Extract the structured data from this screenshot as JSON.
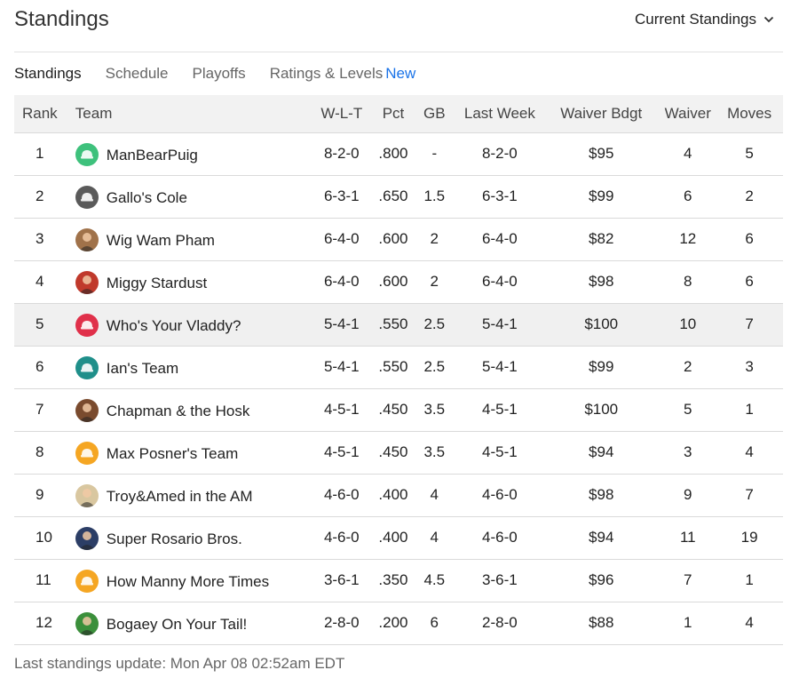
{
  "header": {
    "title": "Standings",
    "dropdown_label": "Current Standings"
  },
  "tabs": [
    {
      "label": "Standings",
      "active": true
    },
    {
      "label": "Schedule",
      "active": false
    },
    {
      "label": "Playoffs",
      "active": false
    },
    {
      "label": "Ratings & Levels",
      "active": false,
      "badge": "New"
    }
  ],
  "table": {
    "columns": [
      "Rank",
      "Team",
      "W-L-T",
      "Pct",
      "GB",
      "Last Week",
      "Waiver Bdgt",
      "Waiver",
      "Moves"
    ],
    "rows": [
      {
        "rank": "1",
        "team": "ManBearPuig",
        "wlt": "8-2-0",
        "pct": ".800",
        "gb": "-",
        "last_week": "8-2-0",
        "waiver_bdgt": "$95",
        "waiver": "4",
        "moves": "5",
        "avatar_color": "#3ec17c",
        "avatar_icon": "cap-icon"
      },
      {
        "rank": "2",
        "team": "Gallo's Cole",
        "wlt": "6-3-1",
        "pct": ".650",
        "gb": "1.5",
        "last_week": "6-3-1",
        "waiver_bdgt": "$99",
        "waiver": "6",
        "moves": "2",
        "avatar_color": "#5a5a5a",
        "avatar_icon": "cap-icon"
      },
      {
        "rank": "3",
        "team": "Wig Wam Pham",
        "wlt": "6-4-0",
        "pct": ".600",
        "gb": "2",
        "last_week": "6-4-0",
        "waiver_bdgt": "$82",
        "waiver": "12",
        "moves": "6",
        "avatar_color": "#a0724a",
        "avatar_icon": "photo-icon"
      },
      {
        "rank": "4",
        "team": "Miggy Stardust",
        "wlt": "6-4-0",
        "pct": ".600",
        "gb": "2",
        "last_week": "6-4-0",
        "waiver_bdgt": "$98",
        "waiver": "8",
        "moves": "6",
        "avatar_color": "#c0392b",
        "avatar_icon": "photo-icon"
      },
      {
        "rank": "5",
        "team": "Who's Your Vladdy?",
        "wlt": "5-4-1",
        "pct": ".550",
        "gb": "2.5",
        "last_week": "5-4-1",
        "waiver_bdgt": "$100",
        "waiver": "10",
        "moves": "7",
        "avatar_color": "#e0304a",
        "avatar_icon": "cap-icon",
        "highlight": true
      },
      {
        "rank": "6",
        "team": "Ian's Team",
        "wlt": "5-4-1",
        "pct": ".550",
        "gb": "2.5",
        "last_week": "5-4-1",
        "waiver_bdgt": "$99",
        "waiver": "2",
        "moves": "3",
        "avatar_color": "#1f8f8a",
        "avatar_icon": "cap-icon"
      },
      {
        "rank": "7",
        "team": "Chapman & the Hosk",
        "wlt": "4-5-1",
        "pct": ".450",
        "gb": "3.5",
        "last_week": "4-5-1",
        "waiver_bdgt": "$100",
        "waiver": "5",
        "moves": "1",
        "avatar_color": "#7a4b2e",
        "avatar_icon": "photo-icon"
      },
      {
        "rank": "8",
        "team": "Max Posner's Team",
        "wlt": "4-5-1",
        "pct": ".450",
        "gb": "3.5",
        "last_week": "4-5-1",
        "waiver_bdgt": "$94",
        "waiver": "3",
        "moves": "4",
        "avatar_color": "#f5a623",
        "avatar_icon": "cap-icon"
      },
      {
        "rank": "9",
        "team": "Troy&Amed in the AM",
        "wlt": "4-6-0",
        "pct": ".400",
        "gb": "4",
        "last_week": "4-6-0",
        "waiver_bdgt": "$98",
        "waiver": "9",
        "moves": "7",
        "avatar_color": "#d9c7a0",
        "avatar_icon": "photo-icon"
      },
      {
        "rank": "10",
        "team": "Super Rosario Bros.",
        "wlt": "4-6-0",
        "pct": ".400",
        "gb": "4",
        "last_week": "4-6-0",
        "waiver_bdgt": "$94",
        "waiver": "11",
        "moves": "19",
        "avatar_color": "#2c3e66",
        "avatar_icon": "photo-icon"
      },
      {
        "rank": "11",
        "team": "How Manny More Times",
        "wlt": "3-6-1",
        "pct": ".350",
        "gb": "4.5",
        "last_week": "3-6-1",
        "waiver_bdgt": "$96",
        "waiver": "7",
        "moves": "1",
        "avatar_color": "#f5a623",
        "avatar_icon": "cap-icon"
      },
      {
        "rank": "12",
        "team": "Bogaey On Your Tail!",
        "wlt": "2-8-0",
        "pct": ".200",
        "gb": "6",
        "last_week": "2-8-0",
        "waiver_bdgt": "$88",
        "waiver": "1",
        "moves": "4",
        "avatar_color": "#3b8f3b",
        "avatar_icon": "photo-icon"
      }
    ]
  },
  "footer": {
    "text": "Last standings update: Mon Apr 08 02:52am EDT"
  }
}
